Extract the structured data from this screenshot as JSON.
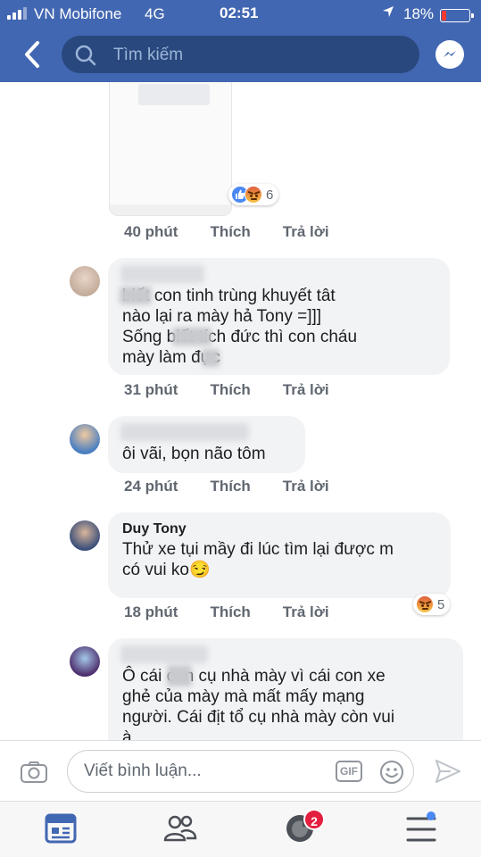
{
  "status_bar": {
    "carrier": "VN Mobifone",
    "network": "4G",
    "time": "02:51",
    "battery_percent": "18%",
    "battery_level": 0.18,
    "battery_color": "#ff3b30"
  },
  "header": {
    "search_placeholder": "Tìm kiếm",
    "accent_color": "#4267b2"
  },
  "comments": [
    {
      "author": "",
      "text": "",
      "time": "40 phút",
      "like_label": "Thích",
      "reply_label": "Trả lời",
      "reactions": [
        "like",
        "angry"
      ],
      "reaction_count": "6"
    },
    {
      "author": "",
      "text": "biết con tinh trùng khuyết tât\nnào lại ra mày hả Tony =]]]\nSống      biết tích đức thì con cháu\nmày làm    đực",
      "time": "31 phút",
      "like_label": "Thích",
      "reply_label": "Trả lời"
    },
    {
      "author": "",
      "text": "ôi vãi, bọn não tôm",
      "time": "24 phút",
      "like_label": "Thích",
      "reply_label": "Trả lời"
    },
    {
      "author": "Duy Tony",
      "text": "Thử xe tụi mầy đi lúc tìm lại được m\ncó vui ko😏",
      "time": "18 phút",
      "like_label": "Thích",
      "reply_label": "Trả lời",
      "reactions": [
        "angry"
      ],
      "reaction_count": "5"
    },
    {
      "author": "",
      "text": "Ô cái      con cụ nhà mày vì cái con xe\nghẻ của mày mà mất mấy mạng\nngười. Cái địt tổ cụ nhà mày còn vui\nà"
    }
  ],
  "composer": {
    "placeholder": "Viết bình luận...",
    "gif_label": "GIF"
  },
  "bottom_nav": {
    "items": [
      "news-feed-icon",
      "friends-icon",
      "notifications-icon",
      "menu-icon"
    ],
    "notification_badge": "2"
  }
}
